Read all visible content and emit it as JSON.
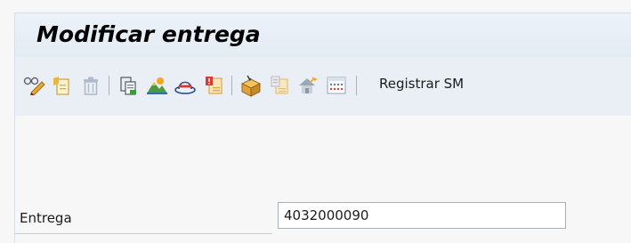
{
  "header": {
    "title": "Modificar entrega"
  },
  "toolbar": {
    "buttons": [
      {
        "icon": "display-change-icon"
      },
      {
        "icon": "create-document-icon"
      },
      {
        "icon": "delete-trash-icon"
      },
      {
        "icon": "copy-document-icon"
      },
      {
        "icon": "mountain-image-icon"
      },
      {
        "icon": "hat-icon"
      },
      {
        "icon": "document-alert-icon"
      },
      {
        "icon": "package-box-icon"
      },
      {
        "icon": "document-grid-icon"
      },
      {
        "icon": "house-arrow-icon"
      },
      {
        "icon": "table-grid-icon"
      }
    ],
    "registrar_label": "Registrar SM"
  },
  "form": {
    "entrega_label": "Entrega",
    "entrega_value": "4032000090"
  },
  "colors": {
    "title_bg": "#e6edf4",
    "toolbar_bg": "#e9eff5",
    "accent_orange": "#f0a830"
  }
}
